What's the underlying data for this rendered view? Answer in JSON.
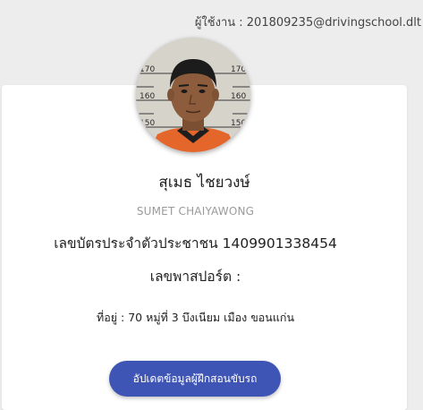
{
  "header": {
    "user_label": "ผู้ใช้งาน : 201809235@drivingschool.dlt"
  },
  "profile": {
    "avatar_icon": "profile-photo",
    "name_th": "สุเมธ ไชยวงษ์",
    "name_en": "SUMET CHAIYAWONG",
    "id_card_line": "เลขบัตรประจำตัวประชาชน 1409901338454",
    "passport_line": "เลขพาสปอร์ต :",
    "address_line": "ที่อยู่ : 70 หมู่ที่ 3 บึงเนียม เมือง ขอนแก่น"
  },
  "actions": {
    "update_button_label": "อัปเดตข้อมูลผู้ฝึกสอนขับรถ"
  },
  "colors": {
    "background": "#ededed",
    "card": "#ffffff",
    "button": "#3f55b5",
    "muted_text": "#9a9a9a"
  }
}
